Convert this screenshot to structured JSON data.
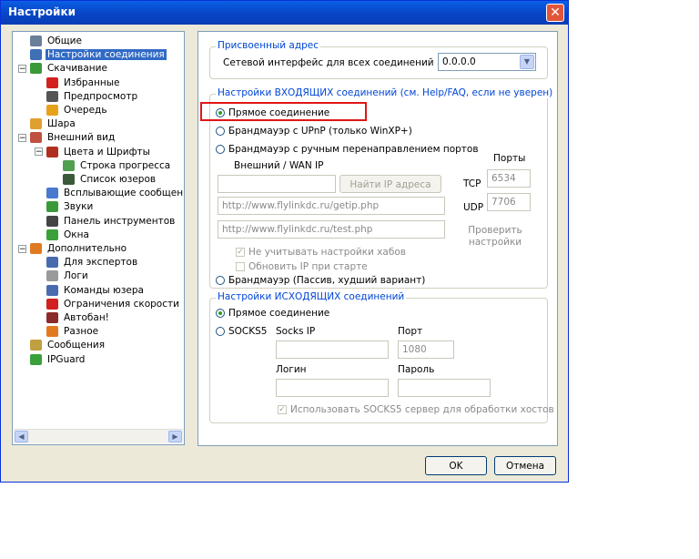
{
  "window": {
    "title": "Настройки",
    "close_glyph": "✕"
  },
  "tree": {
    "items": [
      {
        "label": "Общие",
        "indent": 0,
        "expander": "",
        "icon": "users-icon",
        "color": "#6a7e9a"
      },
      {
        "label": "Настройки соединения",
        "indent": 0,
        "expander": "",
        "icon": "connection-icon",
        "color": "#3f6fb5",
        "selected": true
      },
      {
        "label": "Скачивание",
        "indent": 0,
        "expander": "−",
        "icon": "download-icon",
        "color": "#3a9a3a"
      },
      {
        "label": "Избранные",
        "indent": 1,
        "expander": "",
        "icon": "heart-icon",
        "color": "#d42020"
      },
      {
        "label": "Предпросмотр",
        "indent": 1,
        "expander": "",
        "icon": "preview-icon",
        "color": "#555555"
      },
      {
        "label": "Очередь",
        "indent": 1,
        "expander": "",
        "icon": "queue-icon",
        "color": "#e8a21a"
      },
      {
        "label": "Шара",
        "indent": 0,
        "expander": "",
        "icon": "share-icon",
        "color": "#e0a030"
      },
      {
        "label": "Внешний вид",
        "indent": 0,
        "expander": "−",
        "icon": "appearance-icon",
        "color": "#c05040"
      },
      {
        "label": "Цвета и Шрифты",
        "indent": 1,
        "expander": "−",
        "icon": "palette-icon",
        "color": "#b03020"
      },
      {
        "label": "Строка прогресса",
        "indent": 2,
        "expander": "",
        "icon": "progress-icon",
        "color": "#50a050"
      },
      {
        "label": "Список юзеров",
        "indent": 2,
        "expander": "",
        "icon": "user-list-icon",
        "color": "#3a5a3a"
      },
      {
        "label": "Всплывающие сообщения",
        "indent": 1,
        "expander": "",
        "icon": "popup-icon",
        "color": "#4a7ad0"
      },
      {
        "label": "Звуки",
        "indent": 1,
        "expander": "",
        "icon": "sound-icon",
        "color": "#3a9a3a"
      },
      {
        "label": "Панель инструментов",
        "indent": 1,
        "expander": "",
        "icon": "toolbar-icon",
        "color": "#444444"
      },
      {
        "label": "Окна",
        "indent": 1,
        "expander": "",
        "icon": "windows-icon",
        "color": "#3aa03a"
      },
      {
        "label": "Дополнительно",
        "indent": 0,
        "expander": "−",
        "icon": "advanced-icon",
        "color": "#e07a20"
      },
      {
        "label": "Для экспертов",
        "indent": 1,
        "expander": "",
        "icon": "expert-icon",
        "color": "#4a6ab0"
      },
      {
        "label": "Логи",
        "indent": 1,
        "expander": "",
        "icon": "log-icon",
        "color": "#9a9a9a"
      },
      {
        "label": "Команды юзера",
        "indent": 1,
        "expander": "",
        "icon": "commands-icon",
        "color": "#4a6ab0"
      },
      {
        "label": "Ограничения скорости",
        "indent": 1,
        "expander": "",
        "icon": "speed-limit-icon",
        "color": "#d02020"
      },
      {
        "label": "Автобан!",
        "indent": 1,
        "expander": "",
        "icon": "autoban-icon",
        "color": "#8a2a2a"
      },
      {
        "label": "Разное",
        "indent": 1,
        "expander": "",
        "icon": "misc-icon",
        "color": "#e07a20"
      },
      {
        "label": "Сообщения",
        "indent": 0,
        "expander": "",
        "icon": "messages-icon",
        "color": "#c0a040"
      },
      {
        "label": "IPGuard",
        "indent": 0,
        "expander": "",
        "icon": "ipguard-icon",
        "color": "#3aa03a"
      }
    ],
    "scroll_left": "◀",
    "scroll_right": "▶"
  },
  "assigned": {
    "title": "Присвоенный адрес",
    "label": "Сетевой интерфейс для всех соединений",
    "value": "0.0.0.0",
    "arrow": "▼"
  },
  "incoming": {
    "title": "Настройки ВХОДЯЩИХ соединений (см. Help/FAQ, если не уверен)",
    "direct": "Прямое соединение",
    "upnp": "Брандмауэр с UPnP (только WinXP+)",
    "manual": "Брандмауэр с ручным перенаправлением портов",
    "ports_label": "Порты",
    "wan_label": "Внешний / WAN IP",
    "find_ip": "Найти IP адреса",
    "tcp_label": "TCP",
    "tcp_value": "6534",
    "udp_label": "UDP",
    "udp_value": "7706",
    "url1": "http://www.flylinkdc.ru/getip.php",
    "url2": "http://www.flylinkdc.ru/test.php",
    "check_settings": "Проверить настройки",
    "ignore_hubs": "Не учитывать настройки хабов",
    "update_ip": "Обновить IP при старте",
    "passive": "Брандмауэр (Пассив, худший вариант)"
  },
  "outgoing": {
    "title": "Настройки ИСХОДЯЩИХ соединений",
    "direct": "Прямое соединение",
    "socks5": "SOCKS5",
    "socks_ip_label": "Socks IP",
    "port_label": "Порт",
    "port_value": "1080",
    "login_label": "Логин",
    "password_label": "Пароль",
    "use_socks": "Использовать SOCKS5 сервер для обработки хостов"
  },
  "footer": {
    "ok": "OK",
    "cancel": "Отмена"
  }
}
